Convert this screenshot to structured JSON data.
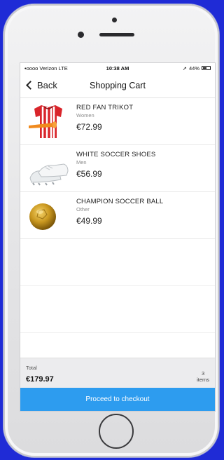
{
  "status": {
    "carrier": "•oooo Verizon  LTE",
    "time": "10:38 AM",
    "battery": "44%"
  },
  "nav": {
    "back_label": "Back",
    "title": "Shopping Cart"
  },
  "items": [
    {
      "name": "RED FAN TRIKOT",
      "category": "Women",
      "price": "€72.99",
      "icon": "red-jersey-icon"
    },
    {
      "name": "WHITE SOCCER SHOES",
      "category": "Men",
      "price": "€56.99",
      "icon": "soccer-shoes-icon"
    },
    {
      "name": "CHAMPION SOCCER BALL",
      "category": "Other",
      "price": "€49.99",
      "icon": "soccer-ball-icon"
    }
  ],
  "footer": {
    "total_label": "Total",
    "total_value": "€179.97",
    "count": "3",
    "count_unit": "items",
    "checkout_label": "Proceed to checkout"
  },
  "colors": {
    "background": "#1f2bd6",
    "accent": "#2d9cef"
  }
}
